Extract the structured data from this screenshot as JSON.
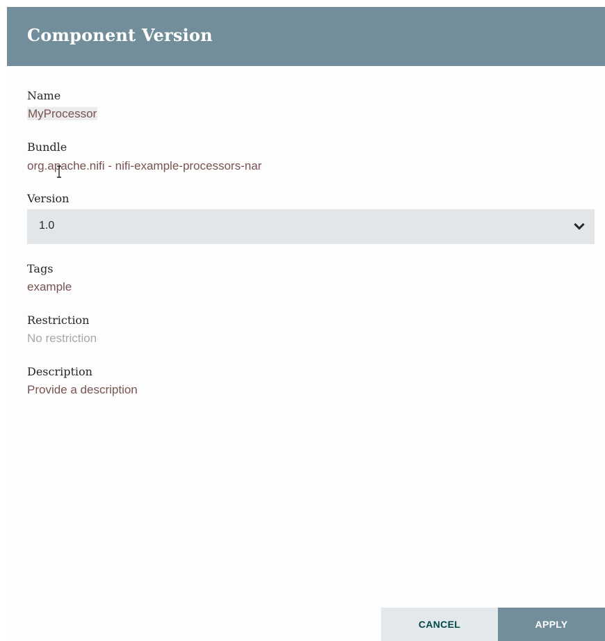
{
  "dialog": {
    "title": "Component Version"
  },
  "fields": {
    "name": {
      "label": "Name",
      "value": "MyProcessor"
    },
    "bundle": {
      "label": "Bundle",
      "value": "org.apache.nifi - nifi-example-processors-nar"
    },
    "version": {
      "label": "Version",
      "selected": "1.0"
    },
    "tags": {
      "label": "Tags",
      "value": "example"
    },
    "restriction": {
      "label": "Restriction",
      "value": "No restriction"
    },
    "description": {
      "label": "Description",
      "value": "Provide a description"
    }
  },
  "buttons": {
    "cancel": "CANCEL",
    "apply": "APPLY"
  },
  "icons": {
    "select_chevron": "chevron-down-icon",
    "mouse_cursor": "text-cursor-icon"
  },
  "colors": {
    "header": "#728e9b",
    "value_text": "#775351",
    "cancel_text": "#004849",
    "select_bg": "#e3e6e8"
  }
}
